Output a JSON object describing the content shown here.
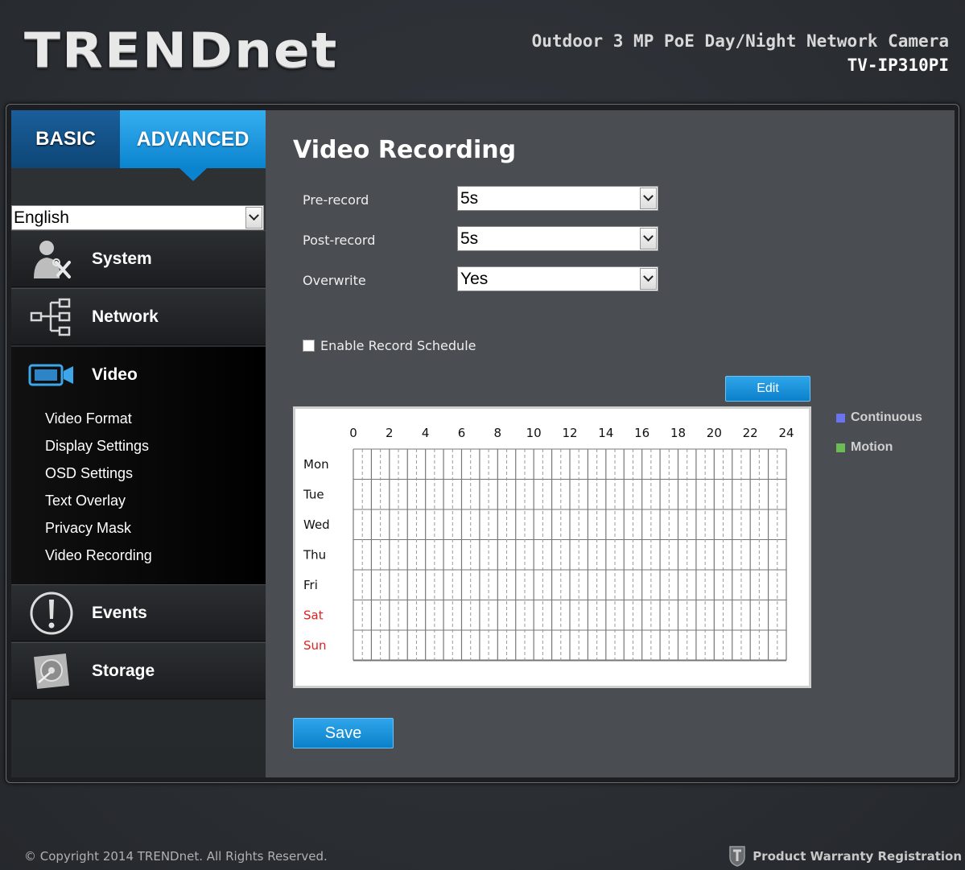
{
  "brand": {
    "logo_text": "TRENDnet"
  },
  "header": {
    "product_name": "Outdoor 3 MP PoE Day/Night Network Camera",
    "model": "TV-IP310PI"
  },
  "sidebar": {
    "tabs": {
      "basic": "BASIC",
      "advanced": "ADVANCED"
    },
    "language": "English",
    "nav": {
      "system": "System",
      "network": "Network",
      "video": "Video",
      "events": "Events",
      "storage": "Storage"
    },
    "video_sub": [
      "Video Format",
      "Display Settings",
      "OSD Settings",
      "Text Overlay",
      "Privacy Mask",
      "Video Recording"
    ]
  },
  "main": {
    "title": "Video Recording",
    "fields": {
      "prerecord_label": "Pre-record",
      "prerecord_value": "5s",
      "postrecord_label": "Post-record",
      "postrecord_value": "5s",
      "overwrite_label": "Overwrite",
      "overwrite_value": "Yes"
    },
    "enable_schedule_label": "Enable Record Schedule",
    "enable_schedule_checked": false,
    "edit_label": "Edit",
    "save_label": "Save",
    "schedule": {
      "hours": [
        "0",
        "2",
        "4",
        "6",
        "8",
        "10",
        "12",
        "14",
        "16",
        "18",
        "20",
        "22",
        "24"
      ],
      "days": [
        "Mon",
        "Tue",
        "Wed",
        "Thu",
        "Fri",
        "Sat",
        "Sun"
      ],
      "weekend_color": "#e02020"
    },
    "legend": {
      "continuous": "Continuous",
      "continuous_color": "#6b74f0",
      "motion": "Motion",
      "motion_color": "#6cbc55"
    }
  },
  "footer": {
    "copyright": "© Copyright 2014 TRENDnet. All Rights Reserved.",
    "warranty": "Product Warranty Registration"
  }
}
